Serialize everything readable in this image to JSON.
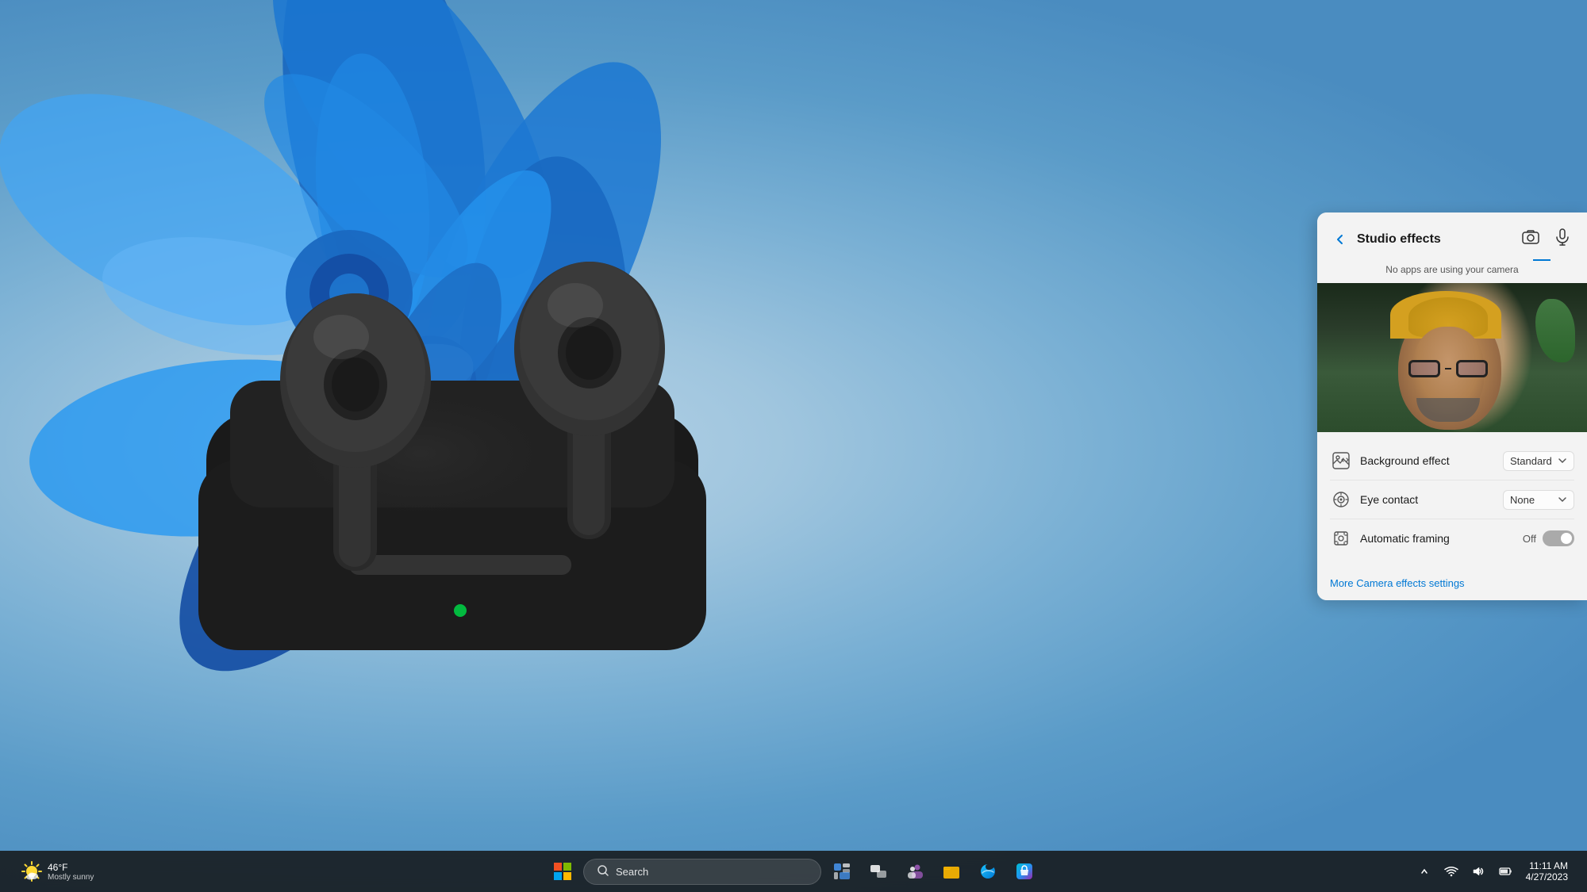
{
  "desktop": {
    "background_colors": [
      "#b8d4e8",
      "#5a9bc8"
    ]
  },
  "studio_panel": {
    "title": "Studio effects",
    "subtitle": "No apps are using your camera",
    "back_label": "←",
    "camera_icon_label": "📷",
    "mic_icon_label": "🎙",
    "settings": [
      {
        "id": "background-effect",
        "icon": "🎭",
        "label": "Background effect",
        "control_type": "dropdown",
        "value": "Standard"
      },
      {
        "id": "eye-contact",
        "icon": "👁",
        "label": "Eye contact",
        "control_type": "dropdown",
        "value": "None"
      },
      {
        "id": "automatic-framing",
        "icon": "🖼",
        "label": "Automatic framing",
        "control_type": "toggle",
        "value": "Off",
        "toggle_state": false
      }
    ],
    "more_settings_link": "More Camera effects settings"
  },
  "taskbar": {
    "weather": {
      "temp": "46°F",
      "condition": "Mostly sunny"
    },
    "search": {
      "placeholder": "Search",
      "label": "Search"
    },
    "apps": [
      {
        "id": "windows-start",
        "label": "Start"
      },
      {
        "id": "search",
        "label": "Search"
      },
      {
        "id": "widgets",
        "label": "Widgets"
      },
      {
        "id": "task-view",
        "label": "Task View"
      },
      {
        "id": "teams",
        "label": "Teams"
      },
      {
        "id": "file-explorer",
        "label": "File Explorer"
      },
      {
        "id": "edge",
        "label": "Microsoft Edge"
      },
      {
        "id": "store",
        "label": "Microsoft Store"
      }
    ],
    "system_tray": {
      "chevron": "^",
      "wifi_icon": "wifi",
      "volume_icon": "vol",
      "battery_icon": "bat"
    },
    "clock": {
      "time": "11:11 AM",
      "date": "4/27/2023"
    }
  }
}
